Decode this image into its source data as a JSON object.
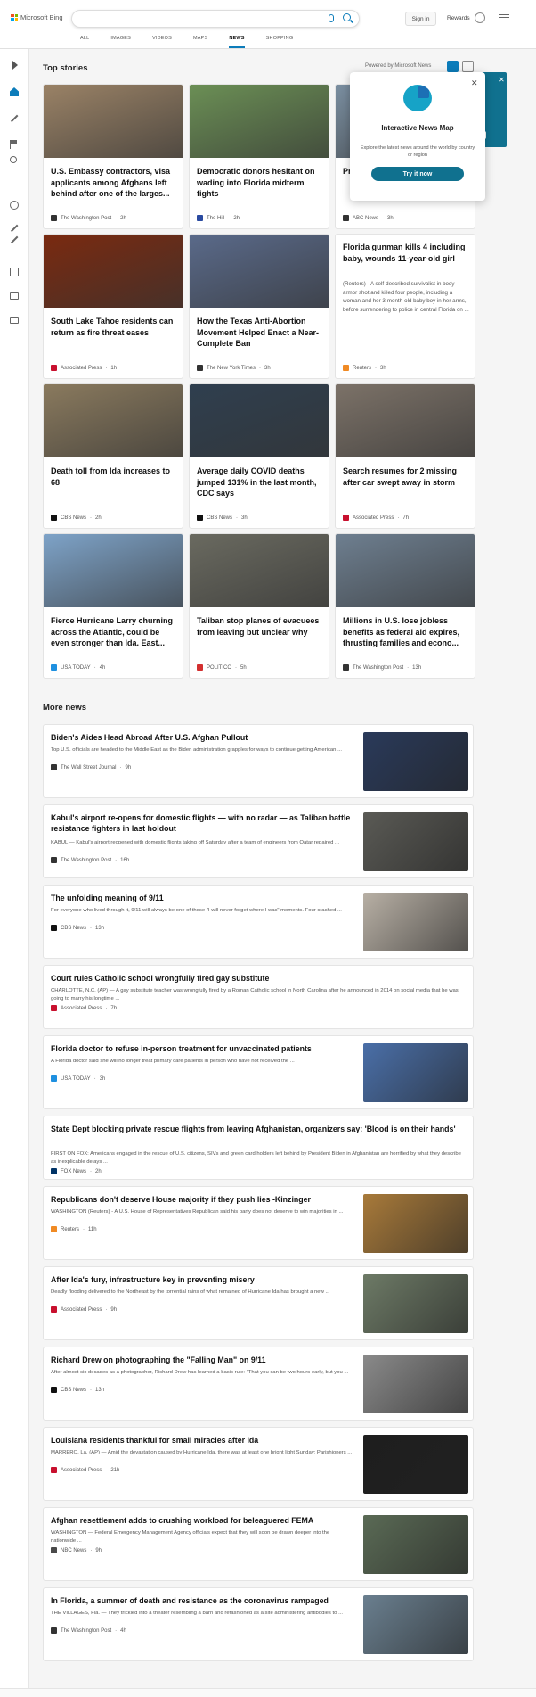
{
  "brand": {
    "name": "Microsoft Bing"
  },
  "search": {
    "value": "",
    "placeholder": ""
  },
  "header": {
    "signin": "Sign in",
    "rewards": "Rewards"
  },
  "tabs": [
    {
      "label": "ALL"
    },
    {
      "label": "IMAGES"
    },
    {
      "label": "VIDEOS"
    },
    {
      "label": "MAPS"
    },
    {
      "label": "NEWS"
    },
    {
      "label": "SHOPPING"
    }
  ],
  "active_tab": "NEWS",
  "sidebar_icons": [
    "collapse-arrow-icon",
    "home-icon",
    "science-icon",
    "flag-icon",
    "location-icon",
    "world-icon",
    "chart-icon",
    "rocket-icon",
    "entertainment-icon",
    "government-icon",
    "money-icon"
  ],
  "top_stories": {
    "heading": "Top stories",
    "powered": "Powered by Microsoft News",
    "cards": [
      {
        "title": "U.S. Embassy contractors, visa applicants among Afghans left behind after one of the larges...",
        "source": "The Washington Post",
        "time": "2h",
        "color": "#9a8266"
      },
      {
        "title": "Democratic donors hesitant on wading into Florida midterm fights",
        "source": "The Hill",
        "time": "2h",
        "color": "#6b8f55"
      },
      {
        "title": "Prom... mont... and s...",
        "source": "ABC News",
        "time": "3h",
        "color": "#7a8ea0"
      },
      {
        "title": "South Lake Tahoe residents can return as fire threat eases",
        "source": "Associated Press",
        "time": "1h",
        "color": "#7a2a10"
      },
      {
        "title": "How the Texas Anti-Abortion Movement Helped Enact a Near-Complete Ban",
        "source": "The New York Times",
        "time": "3h",
        "color": "#5a6a8a"
      },
      {
        "title": "Florida gunman kills 4 including baby, wounds 11-year-old girl",
        "desc": "(Reuters) - A self-described survivalist in body armor shot and killed four people, including a woman and her 3-month-old baby boy in her arms, before surrendering to police in central Florida on ...",
        "source": "Reuters",
        "time": "3h"
      },
      {
        "title": "Death toll from Ida increases to 68",
        "source": "CBS News",
        "time": "2h",
        "color": "#8a7a5e"
      },
      {
        "title": "Average daily COVID deaths jumped 131% in the last month, CDC says",
        "source": "CBS News",
        "time": "3h",
        "color": "#2f3f4f"
      },
      {
        "title": "Search resumes for 2 missing after car swept away in storm",
        "source": "Associated Press",
        "time": "7h",
        "color": "#7c7268"
      },
      {
        "title": "Fierce Hurricane Larry churning across the Atlantic, could be even stronger than Ida. East...",
        "source": "USA TODAY",
        "time": "4h",
        "color": "#7ea3c8"
      },
      {
        "title": "Taliban stop planes of evacuees from leaving but unclear why",
        "source": "POLITICO",
        "time": "5h",
        "color": "#6a6a60"
      },
      {
        "title": "Millions in U.S. lose jobless benefits as federal aid expires, thrusting families and econo...",
        "source": "The Washington Post",
        "time": "13h",
        "color": "#6e7f90"
      }
    ]
  },
  "promo": {
    "title": "Interactive News Map",
    "desc": "Explore the latest news around the world by country or region",
    "button": "Try it now"
  },
  "more_news": {
    "heading": "More news",
    "items": [
      {
        "title": "Biden's Aides Head Abroad After U.S. Afghan Pullout",
        "desc": "Top U.S. officials are headed to the Middle East as the Biden administration grapples for ways to continue getting American ...",
        "source": "The Wall Street Journal",
        "time": "9h",
        "color": "#2a3a5a"
      },
      {
        "title": "Kabul's airport re-opens for domestic flights — with no radar — as Taliban battle resistance fighters in last holdout",
        "desc": "KABUL — Kabul's airport reopened with domestic flights taking off Saturday after a team of engineers from Qatar repaired ...",
        "source": "The Washington Post",
        "time": "16h",
        "color": "#5a5a55"
      },
      {
        "title": "The unfolding meaning of 9/11",
        "desc": "For everyone who lived through it, 9/11 will always be one of those \"I will never forget where I was\" moments. Four crashed ...",
        "source": "CBS News",
        "time": "13h",
        "color": "#b8b0a5"
      },
      {
        "title": "Court rules Catholic school wrongfully fired gay substitute",
        "desc": "CHARLOTTE, N.C. (AP) — A gay substitute teacher was wrongfully fired by a Roman Catholic school in North Carolina after he announced in 2014 on social media that he was going to marry his longtime ...",
        "source": "Associated Press",
        "time": "7h"
      },
      {
        "title": "Florida doctor to refuse in-person treatment for unvaccinated patients",
        "desc": "A Florida doctor said she will no longer treat primary care patients in person who have not received the ...",
        "source": "USA TODAY",
        "time": "3h",
        "color": "#4a6fa8"
      },
      {
        "title": "State Dept blocking private rescue flights from leaving Afghanistan, organizers say: 'Blood is on their hands'",
        "desc": "FIRST ON FOX: Americans engaged in the rescue of U.S. citizens, SIVs and green card holders left behind by President Biden in Afghanistan are horrified by what they describe as inexplicable delays ...",
        "source": "FOX News",
        "time": "2h"
      },
      {
        "title": "Republicans don't deserve House majority if they push lies -Kinzinger",
        "desc": "WASHINGTON (Reuters) - A U.S. House of Representatives Republican said his party does not deserve to win majorities in ...",
        "source": "Reuters",
        "time": "11h",
        "color": "#a87a3a"
      },
      {
        "title": "After Ida's fury, infrastructure key in preventing misery",
        "desc": "Deadly flooding delivered to the Northeast by the torrential rains of what remained of Hurricane Ida has brought a new ...",
        "source": "Associated Press",
        "time": "9h",
        "color": "#6d7a66"
      },
      {
        "title": "Richard Drew on photographing the \"Falling Man\" on 9/11",
        "desc": "After almost six decades as a photographer, Richard Drew has learned a basic rule: \"That you can be two hours early, but you ...",
        "source": "CBS News",
        "time": "13h",
        "color": "#8a8a8a"
      },
      {
        "title": "Louisiana residents thankful for small miracles after Ida",
        "desc": "MARRERO, La. (AP) — Amid the devastation caused by Hurricane Ida, there was at least one bright light Sunday: Parishioners ...",
        "source": "Associated Press",
        "time": "21h",
        "color": "#1e1e1e"
      },
      {
        "title": "Afghan resettlement adds to crushing workload for beleaguered FEMA",
        "desc": "WASHINGTON — Federal Emergency Management Agency officials expect that they will soon be drawn deeper into the nationwide ...",
        "source": "NBC News",
        "time": "9h",
        "color": "#5a6a55"
      },
      {
        "title": "In Florida, a summer of death and resistance as the coronavirus rampaged",
        "desc": "THE VILLAGES, Fla. — They trickled into a theater resembling a barn and refashioned as a site administering antibodies to ...",
        "source": "The Washington Post",
        "time": "4h",
        "color": "#6a7f8f"
      }
    ]
  },
  "colors": {
    "accent": "#0c7cba",
    "promo_button": "#10718f",
    "ap": "#c8102e",
    "reuters": "#f08a24",
    "usatoday": "#1e90e0",
    "fox": "#003366",
    "cbs": "#111111",
    "wapo": "#333333",
    "nbc": "#4a4a4a",
    "hill": "#2a4aa0",
    "nyt": "#333333",
    "politico": "#d32f2f",
    "abc": "#222222",
    "wsj": "#555555"
  }
}
